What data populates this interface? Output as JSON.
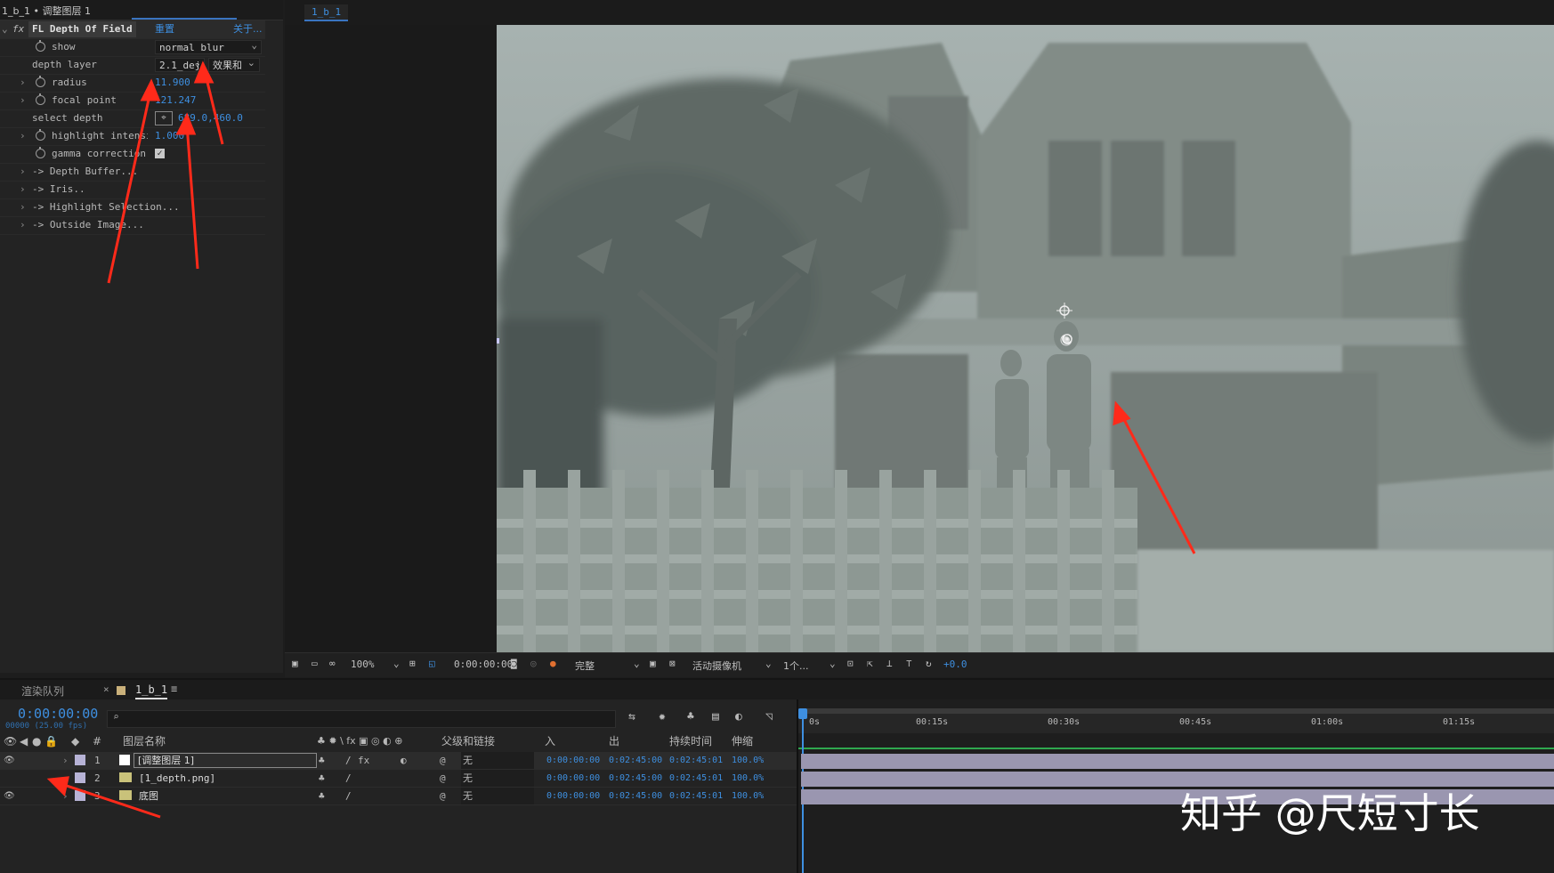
{
  "fx_panel": {
    "title": "1_b_1 • 调整图层 1",
    "effect_name": "FL Depth Of Field",
    "reset": "重置",
    "about": "关于...",
    "show_label": "show",
    "show_value": "normal blur",
    "depth_layer_label": "depth layer",
    "depth_layer_value": "2.1_dej",
    "depth_layer_mode": "效果和",
    "radius_label": "radius",
    "radius_value": "11.900",
    "focal_label": "focal point",
    "focal_value": "121.247",
    "select_depth_label": "select depth",
    "select_depth_value": "689.0,460.0",
    "highlight_label": "highlight intensity",
    "highlight_value": "1.000",
    "gamma_label": "gamma correction",
    "groups": [
      "-> Depth Buffer...",
      "-> Iris..",
      "-> Highlight Selection...",
      "-> Outside Image..."
    ]
  },
  "viewer": {
    "tab": "1_b_1",
    "zoom": "100%",
    "timecode": "0:00:00:00",
    "quality": "完整",
    "camera": "活动摄像机",
    "views": "1个...",
    "exposure": "+0.0"
  },
  "timeline": {
    "tab_render": "渲染队列",
    "tab_comp": "1_b_1",
    "current_time": "0:00:00:00",
    "frames": "00000 (25.00 fps)",
    "col_num": "#",
    "col_name": "图层名称",
    "col_parent": "父级和链接",
    "col_in": "入",
    "col_out": "出",
    "col_duration": "持续时间",
    "col_stretch": "伸缩",
    "ruler": [
      "0s",
      "00:15s",
      "00:30s",
      "00:45s",
      "01:00s",
      "01:15s"
    ],
    "layers": [
      {
        "num": "1",
        "name": "[调整图层 1]",
        "parent": "无",
        "in": "0:00:00:00",
        "out": "0:02:45:00",
        "dur": "0:02:45:01",
        "stretch": "100.0%"
      },
      {
        "num": "2",
        "name": "[1_depth.png]",
        "parent": "无",
        "in": "0:00:00:00",
        "out": "0:02:45:00",
        "dur": "0:02:45:01",
        "stretch": "100.0%"
      },
      {
        "num": "3",
        "name": "底图",
        "parent": "无",
        "in": "0:00:00:00",
        "out": "0:02:45:00",
        "dur": "0:02:45:01",
        "stretch": "100.0%"
      }
    ]
  },
  "watermark": "知乎 @尺短寸长",
  "colors": {
    "accent": "#3e8fe0",
    "arrow": "#ff2a1a",
    "scene": "#8a948f",
    "layer_bar": "#9a96b0"
  }
}
